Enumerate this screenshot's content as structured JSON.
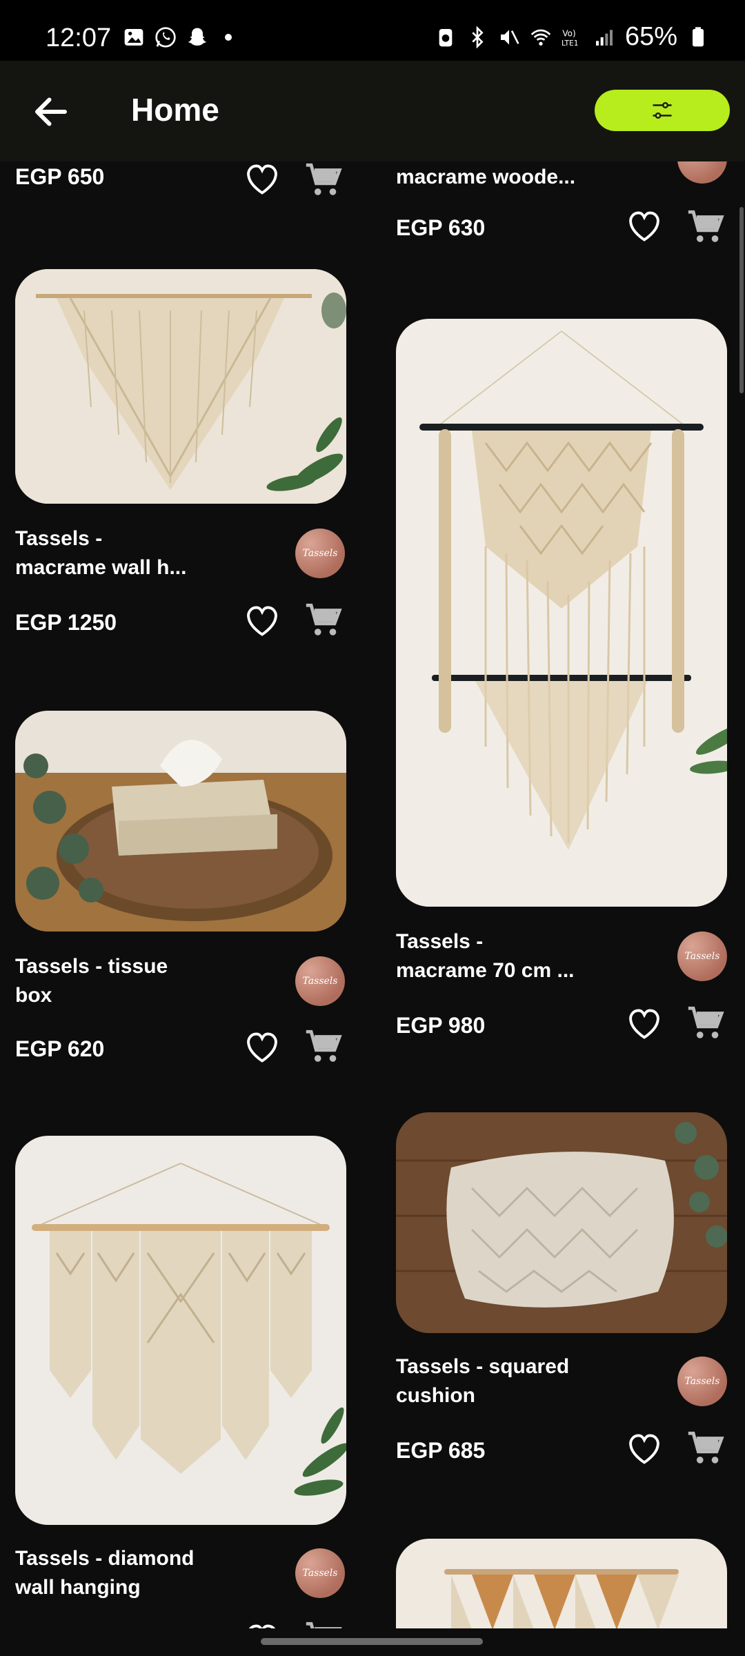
{
  "status_bar": {
    "time": "12:07",
    "battery": "65%"
  },
  "app_bar": {
    "title": "Home"
  },
  "products": [
    {
      "name": "",
      "price": "EGP 650"
    },
    {
      "name": "macrame woode...",
      "price": "EGP 630"
    },
    {
      "name": "Tassels - macrame wall h...",
      "name_line1": "Tassels -",
      "name_line2": "macrame wall h...",
      "price": "EGP 1250"
    },
    {
      "name_line1": "Tassels -",
      "name_line2": "macrame 70 cm ...",
      "price": "EGP 980"
    },
    {
      "name_line1": "Tassels - tissue",
      "name_line2": "box",
      "price": "EGP 620"
    },
    {
      "name_line1": "Tassels - squared",
      "name_line2": "cushion",
      "price": "EGP 685"
    },
    {
      "name_line1": "Tassels - diamond",
      "name_line2": "wall hanging"
    }
  ],
  "shop_avatar_text": "Tassels",
  "colors": {
    "accent": "#b7ec1d",
    "background": "#0d0d0d",
    "appbar": "#141510"
  }
}
